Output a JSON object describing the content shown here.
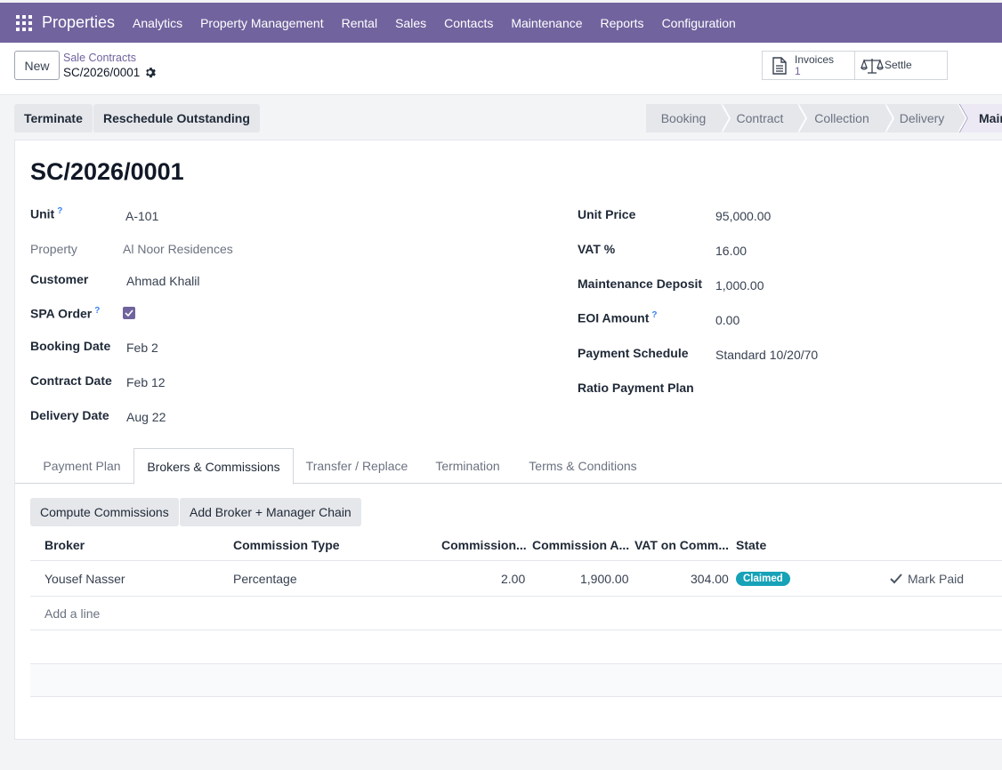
{
  "navbar": {
    "brand": "Properties",
    "menu": [
      "Analytics",
      "Property Management",
      "Rental",
      "Sales",
      "Contacts",
      "Maintenance",
      "Reports",
      "Configuration"
    ]
  },
  "control": {
    "new_label": "New",
    "breadcrumb_parent": "Sale Contracts",
    "breadcrumb_current": "SC/2026/0001",
    "invoices_label": "Invoices",
    "invoices_count": "1",
    "settle_label": "Settle"
  },
  "actions": {
    "terminate": "Terminate",
    "reschedule": "Reschedule Outstanding"
  },
  "status_stages": [
    "Booking",
    "Contract",
    "Collection",
    "Delivery",
    "Main"
  ],
  "record": {
    "title": "SC/2026/0001",
    "left_fields": [
      {
        "label": "Unit",
        "value": "A-101",
        "help": "?"
      },
      {
        "label": "Property",
        "value": "Al Noor Residences"
      },
      {
        "label": "Customer",
        "value": "Ahmad Khalil"
      },
      {
        "label": "SPA Order",
        "help": "?",
        "checked": true
      },
      {
        "label": "Booking Date",
        "value": "Feb 2"
      },
      {
        "label": "Contract Date",
        "value": "Feb 12"
      },
      {
        "label": "Delivery Date",
        "value": "Aug 22"
      }
    ],
    "right_fields": [
      {
        "label": "Unit Price",
        "value": "95,000.00"
      },
      {
        "label": "VAT %",
        "value": "16.00"
      },
      {
        "label": "Maintenance Deposit",
        "value": "1,000.00"
      },
      {
        "label": "EOI Amount",
        "value": "0.00",
        "help": "?"
      },
      {
        "label": "Payment Schedule",
        "value": "Standard 10/20/70"
      },
      {
        "label": "Ratio Payment Plan",
        "value": ""
      }
    ]
  },
  "tabs": [
    "Payment Plan",
    "Brokers & Commissions",
    "Transfer / Replace",
    "Termination",
    "Terms & Conditions"
  ],
  "brokers": {
    "compute_label": "Compute Commissions",
    "add_chain_label": "Add Broker + Manager Chain",
    "columns": [
      "Broker",
      "Commission Type",
      "Commission...",
      "Commission A...",
      "VAT on Comm...",
      "State"
    ],
    "rows": [
      {
        "broker": "Yousef Nasser",
        "type": "Percentage",
        "rate": "2.00",
        "amount": "1,900.00",
        "vat": "304.00",
        "state": "Claimed",
        "action": "Mark Paid"
      }
    ],
    "add_line": "Add a line"
  },
  "colors": {
    "navbar": "#71639e",
    "badge_claimed": "#17a2b8"
  }
}
